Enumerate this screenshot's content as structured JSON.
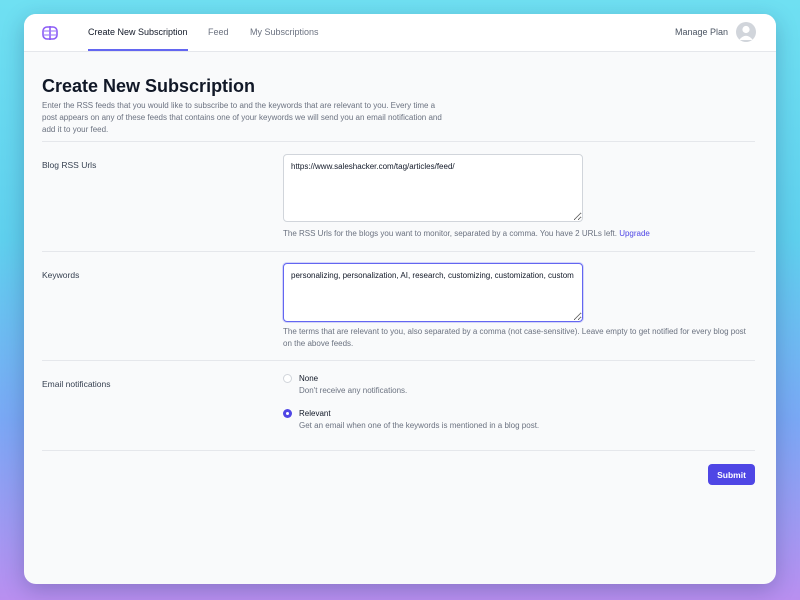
{
  "nav": {
    "tabs": [
      {
        "label": "Create New Subscription",
        "active": true
      },
      {
        "label": "Feed",
        "active": false
      },
      {
        "label": "My Subscriptions",
        "active": false
      }
    ],
    "manage_plan": "Manage Plan"
  },
  "page": {
    "title": "Create New Subscription",
    "intro": "Enter the RSS feeds that you would like to subscribe to and the keywords that are relevant to you. Every time a post appears on any of these feeds that contains one of your keywords we will send you an email notification and add it to your feed."
  },
  "rss": {
    "label": "Blog RSS Urls",
    "value": "https://www.saleshacker.com/tag/articles/feed/",
    "help": "The RSS Urls for the blogs you want to monitor, separated by a comma. You have 2 URLs left.",
    "upgrade": "Upgrade"
  },
  "keywords": {
    "label": "Keywords",
    "value": "personalizing, personalization, AI, research, customizing, customization, custom",
    "help": "The terms that are relevant to you, also separated by a comma (not case-sensitive). Leave empty to get notified for every blog post on the above feeds."
  },
  "notifications": {
    "label": "Email notifications",
    "options": [
      {
        "label": "None",
        "description": "Don't receive any notifications.",
        "checked": false
      },
      {
        "label": "Relevant",
        "description": "Get an email when one of the keywords is mentioned in a blog post.",
        "checked": true
      }
    ]
  },
  "submit_label": "Submit",
  "colors": {
    "accent": "#4f46e5",
    "tab_underline": "#6366f1",
    "logo": "#8b5cf6"
  },
  "icons": {
    "logo": "brain-logo-icon",
    "avatar": "user-avatar-icon"
  }
}
